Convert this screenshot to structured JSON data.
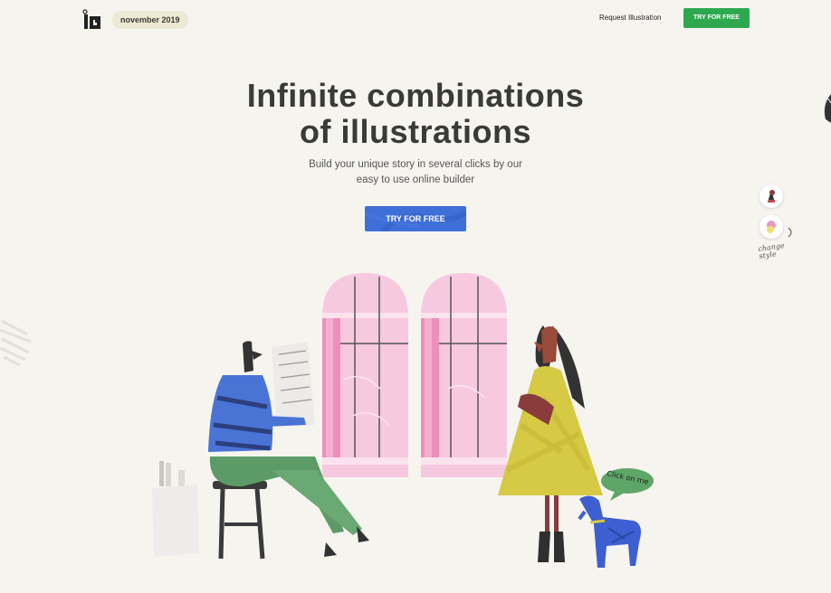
{
  "header": {
    "logo_icon": "logo-icon",
    "date_badge": "november 2019",
    "request_link": "Request Illustration",
    "try_button": "TRY FOR FREE"
  },
  "hero": {
    "title_line1": "Infinite combinations",
    "title_line2": "of illustrations",
    "subtitle_line1": "Build your unique story in several clicks by our",
    "subtitle_line2": "easy to use online builder",
    "cta": "TRY FOR FREE"
  },
  "style_switcher": {
    "label_line1": "change",
    "label_line2": "style"
  },
  "scene": {
    "bubble_text": "Click on me"
  },
  "colors": {
    "background": "#f6f4ee",
    "green_button": "#2ea84f",
    "blue_button": "#3f6fd8",
    "window_pink": "#f7c9df",
    "dog_blue": "#3d5fd1",
    "dress_yellow": "#d6c944"
  }
}
